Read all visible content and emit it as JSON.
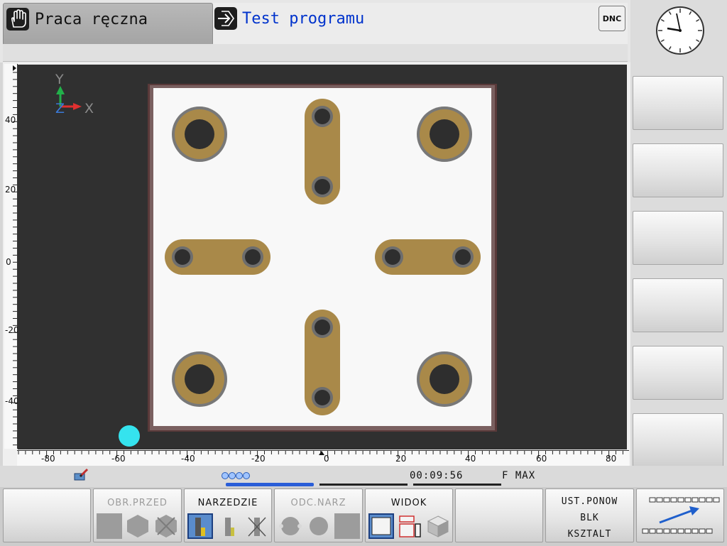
{
  "header": {
    "mode_manual": {
      "title": "Praca ręczna",
      "icon": "hand-icon"
    },
    "mode_test": {
      "title": "Test programu",
      "icon": "program-arrow-icon"
    },
    "dnc_label": "DNC"
  },
  "colors": {
    "workpiece": "#f8f8f8",
    "machined": "#a98949",
    "hole": "#2e2e2e",
    "tool_marker": "#35e3ee",
    "view_background": "#303030",
    "title_blue": "#0033cc"
  },
  "graphics": {
    "axis_labels": {
      "x": "X",
      "y": "Y",
      "z": "Z"
    },
    "ruler_x_labels": [
      "-80",
      "-60",
      "-40",
      "-20",
      "0",
      "20",
      "40",
      "60",
      "80"
    ],
    "ruler_y_labels": [
      "40",
      "20",
      "0",
      "-20",
      "-40"
    ]
  },
  "status": {
    "time": "00:09:56",
    "feed": "F MAX"
  },
  "softkeys": {
    "obr_przed": "OBR.PRZED",
    "narzedzie": "NARZEDZIE",
    "odc_narz": "ODC.NARZ",
    "widok": "WIDOK",
    "reset_line1": "UST.PONOW",
    "reset_line2": "BLK",
    "reset_line3": "KSZTALT"
  }
}
